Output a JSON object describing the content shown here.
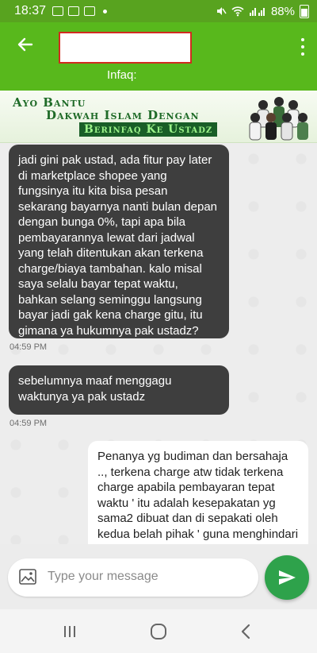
{
  "status_bar": {
    "time": "18:37",
    "battery": "88%"
  },
  "app_bar": {
    "subtitle": "Infaq:"
  },
  "banner": {
    "line1": "Ayo Bantu",
    "line2": "Dakwah Islam Dengan",
    "line3": "Berinfaq Ke Ustadz"
  },
  "messages": [
    {
      "side": "in",
      "text": "jadi gini pak ustad, ada fitur pay later di marketplace shopee yang fungsinya itu kita bisa pesan sekarang bayarnya nanti bulan depan dengan bunga 0%, tapi apa bila pembayarannya lewat dari jadwal yang telah ditentukan akan terkena charge/biaya tambahan. kalo misal saya selalu bayar tepat waktu, bahkan selang seminggu langsung bayar jadi gak kena charge gitu, itu gimana ya hukumnya pak ustadz?",
      "time": "04:59 PM"
    },
    {
      "side": "in",
      "text": "sebelumnya maaf menggagu waktunya ya pak ustadz",
      "time": "04:59 PM"
    },
    {
      "side": "out",
      "text": "Penanya yg budiman dan bersahaja .., terkena charge atw tidak terkena charge apabila pembayaran tepat waktu ' itu adalah kesepakatan yg sama2 dibuat dan di sepakati oleh kedua belah pihak ' guna menghindari adanya pihak"
    }
  ],
  "input": {
    "placeholder": "Type your message"
  },
  "colors": {
    "status_bar": "#58a31f",
    "app_bar": "#58b81c",
    "incoming_bubble": "#3e3e3e",
    "send_button": "#2ea24b"
  }
}
